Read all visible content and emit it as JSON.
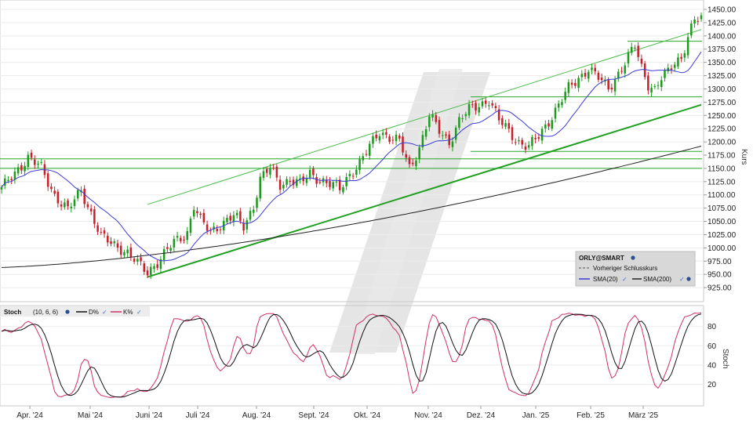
{
  "chart_data": [
    {
      "type": "candlestick",
      "ylabel": "Kurs",
      "ylim": [
        910,
        1460
      ],
      "y_ticks": [
        "1450.00",
        "1425.00",
        "1400.00",
        "1375.00",
        "1350.00",
        "1325.00",
        "1300.00",
        "1275.00",
        "1250.00",
        "1225.00",
        "1200.00",
        "1175.00",
        "1150.00",
        "1125.00",
        "1100.00",
        "1075.00",
        "1050.00",
        "1025.00",
        "1000.00",
        "975.00",
        "950.00",
        "925.00"
      ],
      "x_labels": [
        "Apr. '24",
        "Mai '24",
        "Juni '24",
        "Juli '24",
        "Aug. '24",
        "Sept. '24",
        "Okt. '24",
        "Nov. '24",
        "Dez. '24",
        "Jan. '25",
        "Feb. '25",
        "März '25"
      ],
      "close_anchors": [
        [
          0,
          1110
        ],
        [
          5,
          1150
        ],
        [
          8,
          1170
        ],
        [
          12,
          1150
        ],
        [
          16,
          1100
        ],
        [
          20,
          1070
        ],
        [
          24,
          1110
        ],
        [
          26,
          1080
        ],
        [
          28,
          1050
        ],
        [
          30,
          1020
        ],
        [
          33,
          1010
        ],
        [
          36,
          1000
        ],
        [
          38,
          990
        ],
        [
          41,
          970
        ],
        [
          44,
          955
        ],
        [
          48,
          980
        ],
        [
          52,
          1010
        ],
        [
          56,
          1030
        ],
        [
          58,
          1080
        ],
        [
          60,
          1050
        ],
        [
          63,
          1030
        ],
        [
          66,
          1045
        ],
        [
          70,
          1060
        ],
        [
          73,
          1040
        ],
        [
          76,
          1080
        ],
        [
          78,
          1130
        ],
        [
          81,
          1150
        ],
        [
          84,
          1120
        ],
        [
          87,
          1130
        ],
        [
          90,
          1120
        ],
        [
          93,
          1140
        ],
        [
          96,
          1130
        ],
        [
          99,
          1120
        ],
        [
          102,
          1110
        ],
        [
          105,
          1140
        ],
        [
          108,
          1160
        ],
        [
          111,
          1190
        ],
        [
          114,
          1220
        ],
        [
          117,
          1210
        ],
        [
          120,
          1200
        ],
        [
          123,
          1150
        ],
        [
          126,
          1190
        ],
        [
          129,
          1250
        ],
        [
          132,
          1220
        ],
        [
          135,
          1200
        ],
        [
          138,
          1240
        ],
        [
          141,
          1260
        ],
        [
          144,
          1270
        ],
        [
          147,
          1280
        ],
        [
          150,
          1240
        ],
        [
          153,
          1220
        ],
        [
          156,
          1200
        ],
        [
          159,
          1190
        ],
        [
          162,
          1210
        ],
        [
          165,
          1240
        ],
        [
          168,
          1270
        ],
        [
          171,
          1300
        ],
        [
          174,
          1320
        ],
        [
          177,
          1340
        ],
        [
          180,
          1320
        ],
        [
          183,
          1300
        ],
        [
          186,
          1330
        ],
        [
          189,
          1360
        ],
        [
          191,
          1380
        ],
        [
          193,
          1340
        ],
        [
          195,
          1310
        ],
        [
          197,
          1300
        ],
        [
          199,
          1320
        ],
        [
          201,
          1330
        ],
        [
          203,
          1350
        ],
        [
          205,
          1360
        ],
        [
          207,
          1400
        ],
        [
          209,
          1430
        ]
      ],
      "series": [
        {
          "name": "SMA(20)",
          "color": "#3b3bd6"
        },
        {
          "name": "SMA(200)",
          "color": "#222222"
        }
      ],
      "legend": {
        "title": "ORLY@SMART",
        "prev_close": "Vorheriger Schlusskurs",
        "sma20": "SMA(20)",
        "sma200": "SMA(200)"
      },
      "horizontal_levels": [
        1390,
        1285,
        1182,
        1168,
        1150
      ],
      "trendlines": [
        {
          "from": [
            44,
            945
          ],
          "to": [
            211,
            1270
          ],
          "color": "#20a020",
          "role": "support"
        },
        {
          "from": [
            44,
            1082
          ],
          "to": [
            211,
            1412
          ],
          "color": "#4cbe4c",
          "role": "upper-channel"
        }
      ]
    },
    {
      "type": "line",
      "title": "Stoch",
      "params": "(10, 6, 6)",
      "ylabel": "Stoch",
      "ylim": [
        0,
        100
      ],
      "y_ticks": [
        "80",
        "60",
        "40",
        "20"
      ],
      "series": [
        {
          "name": "D%",
          "color": "#111111"
        },
        {
          "name": "K%",
          "color": "#d0306a"
        }
      ]
    }
  ],
  "watermark": "/"
}
